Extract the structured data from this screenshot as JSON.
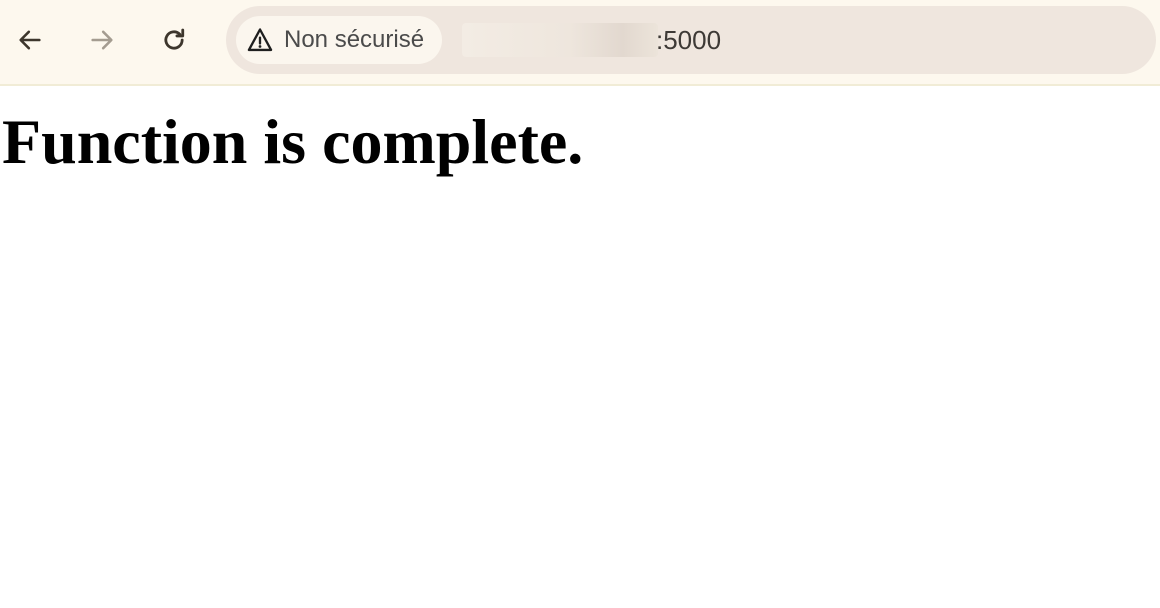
{
  "browser": {
    "toolbar": {
      "back_icon": "arrow-left-icon",
      "forward_icon": "arrow-right-icon",
      "reload_icon": "reload-icon"
    },
    "omnibox": {
      "security_icon": "warning-triangle-icon",
      "security_label": "Non sécurisé",
      "url_visible_suffix": ":5000",
      "url_host_redacted": true
    },
    "colors": {
      "toolbar_bg": "#fdf8ee",
      "omnibox_bg": "#efe6de",
      "chip_bg": "#fbf6ee"
    }
  },
  "page": {
    "heading": "Function is complete."
  }
}
